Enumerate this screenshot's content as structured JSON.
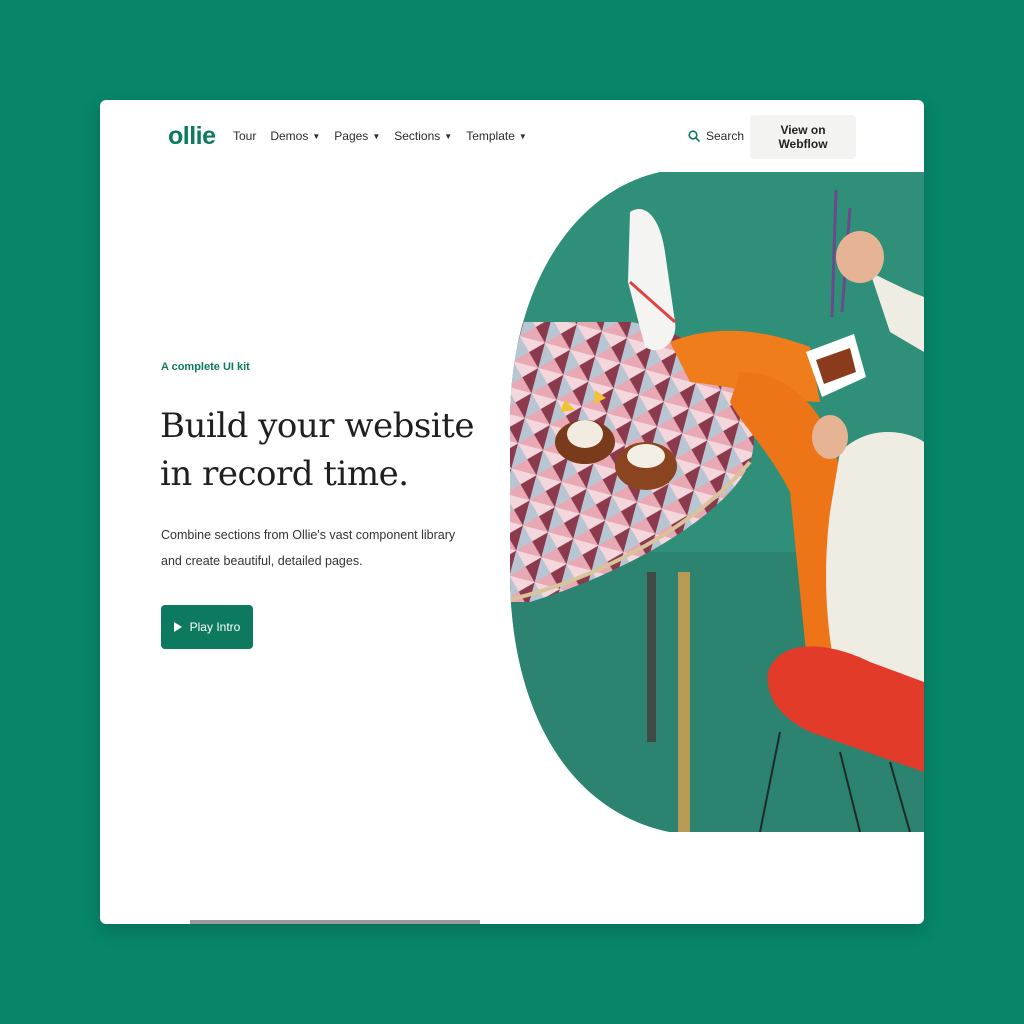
{
  "brand": {
    "logo": "ollie",
    "accent": "#0d7a5f",
    "page_bg": "#07866a"
  },
  "nav": {
    "items": [
      {
        "label": "Tour",
        "dropdown": false
      },
      {
        "label": "Demos",
        "dropdown": true
      },
      {
        "label": "Pages",
        "dropdown": true
      },
      {
        "label": "Sections",
        "dropdown": true
      },
      {
        "label": "Template",
        "dropdown": true
      }
    ],
    "search_label": "Search",
    "search_icon": "search-icon",
    "cta_label": "View on Webflow"
  },
  "hero": {
    "eyebrow": "A complete UI kit",
    "headline": "Build your website in record time.",
    "subtext": "Combine sections from Ollie's vast component library and create beautiful, detailed pages.",
    "button_label": "Play Intro",
    "button_icon": "play-icon",
    "image_alt_subject": "person in orange tights eating noodles at a patterned table"
  }
}
